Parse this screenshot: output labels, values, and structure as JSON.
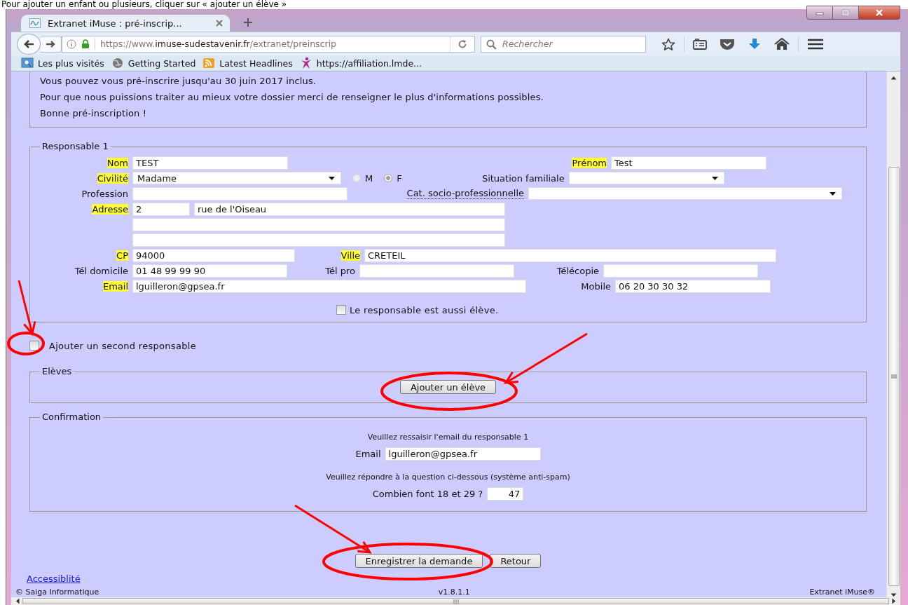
{
  "caption": "Pour ajouter un enfant ou plusieurs, cliquer sur « ajouter un élève »",
  "browser": {
    "tab": {
      "title": "Extranet iMuse : pré-inscrip..."
    },
    "url": {
      "prefix": "https://www.",
      "host": "imuse-sudestavenir.fr",
      "path": "/extranet/preinscrip"
    },
    "search": {
      "placeholder": "Rechercher"
    },
    "bookmarks": [
      {
        "kind": "folder",
        "label": "Les plus visités"
      },
      {
        "kind": "globe",
        "label": "Getting Started"
      },
      {
        "kind": "feed",
        "label": "Latest Headlines"
      },
      {
        "kind": "figure",
        "label": "https://affiliation.lmde..."
      }
    ]
  },
  "intro": [
    "Vous pouvez vous pré-inscrire jusqu'au 30 juin 2017 inclus.",
    "Pour que nous puissions traiter au mieux votre dossier merci de renseigner le plus d'informations possibles.",
    "Bonne pré-inscription !"
  ],
  "responsable": {
    "legend": "Responsable 1",
    "rows": [
      [
        {
          "kind": "text",
          "label": "Nom",
          "required": true,
          "value": "TEST"
        },
        {
          "kind": "text",
          "label": "Prénom",
          "required": true,
          "value": "Test"
        }
      ],
      [
        {
          "kind": "select",
          "label": "Civilité",
          "required": true,
          "value": "Madame"
        },
        {
          "kind": "radio",
          "label": "M",
          "selected": false
        },
        {
          "kind": "radio",
          "label": "F",
          "selected": true
        },
        {
          "kind": "select",
          "label": "Situation familiale",
          "required": false
        }
      ],
      [
        {
          "kind": "text",
          "label": "Profession",
          "required": false
        },
        {
          "kind": "select",
          "label": "Cat. socio-professionnelle",
          "required": false,
          "hint": true
        }
      ],
      [
        {
          "kind": "text",
          "label": "Adresse",
          "required": true,
          "value": "2"
        },
        {
          "kind": "text",
          "value": "rue de l'Oiseau"
        }
      ],
      [
        {
          "kind": "text"
        }
      ],
      [
        {
          "kind": "text"
        }
      ],
      [
        {
          "kind": "text",
          "label": "CP",
          "required": true,
          "value": "94000"
        },
        {
          "kind": "text",
          "label": "Ville",
          "required": true,
          "value": "CRETEIL"
        }
      ],
      [
        {
          "kind": "text",
          "label": "Tél domicile",
          "required": false,
          "value": "01 48 99 99 90"
        },
        {
          "kind": "text",
          "label": "Tél pro",
          "required": false
        },
        {
          "kind": "text",
          "label": "Télécopie",
          "required": false
        }
      ],
      [
        {
          "kind": "text",
          "label": "Email",
          "required": true,
          "value": "lguilleron@gpsea.fr"
        },
        {
          "kind": "text",
          "label": "Mobile",
          "required": false,
          "value": "06 20 30 30 32"
        }
      ]
    ],
    "also_student": {
      "label": "Le responsable est aussi élève.",
      "checked": false
    }
  },
  "second_responsable": {
    "label": "Ajouter un second responsable",
    "checked": false
  },
  "eleves": {
    "legend": "Elèves",
    "button": "Ajouter un élève"
  },
  "confirmation": {
    "legend": "Confirmation",
    "email_prompt": "Veuillez ressaisir l'email du responsable 1",
    "email": {
      "label": "Email",
      "value": "lguilleron@gpsea.fr"
    },
    "spam_prompt": "Veuillez répondre à la question ci-dessous (système anti-spam)",
    "question": {
      "label": "Combien font 18 et 29 ?",
      "value": "47"
    }
  },
  "actions": [
    "Enregistrer la demande",
    "Retour"
  ],
  "link": "Accessiblité",
  "footer": {
    "left": "© Saiga Informatique",
    "center": "v1.8.1.1",
    "right": "Extranet iMuse®"
  },
  "annotations": [
    {
      "kind": "arrow"
    },
    {
      "kind": "ellipse"
    },
    {
      "kind": "arrow"
    },
    {
      "kind": "ellipse"
    },
    {
      "kind": "arrow"
    },
    {
      "kind": "ellipse"
    }
  ]
}
